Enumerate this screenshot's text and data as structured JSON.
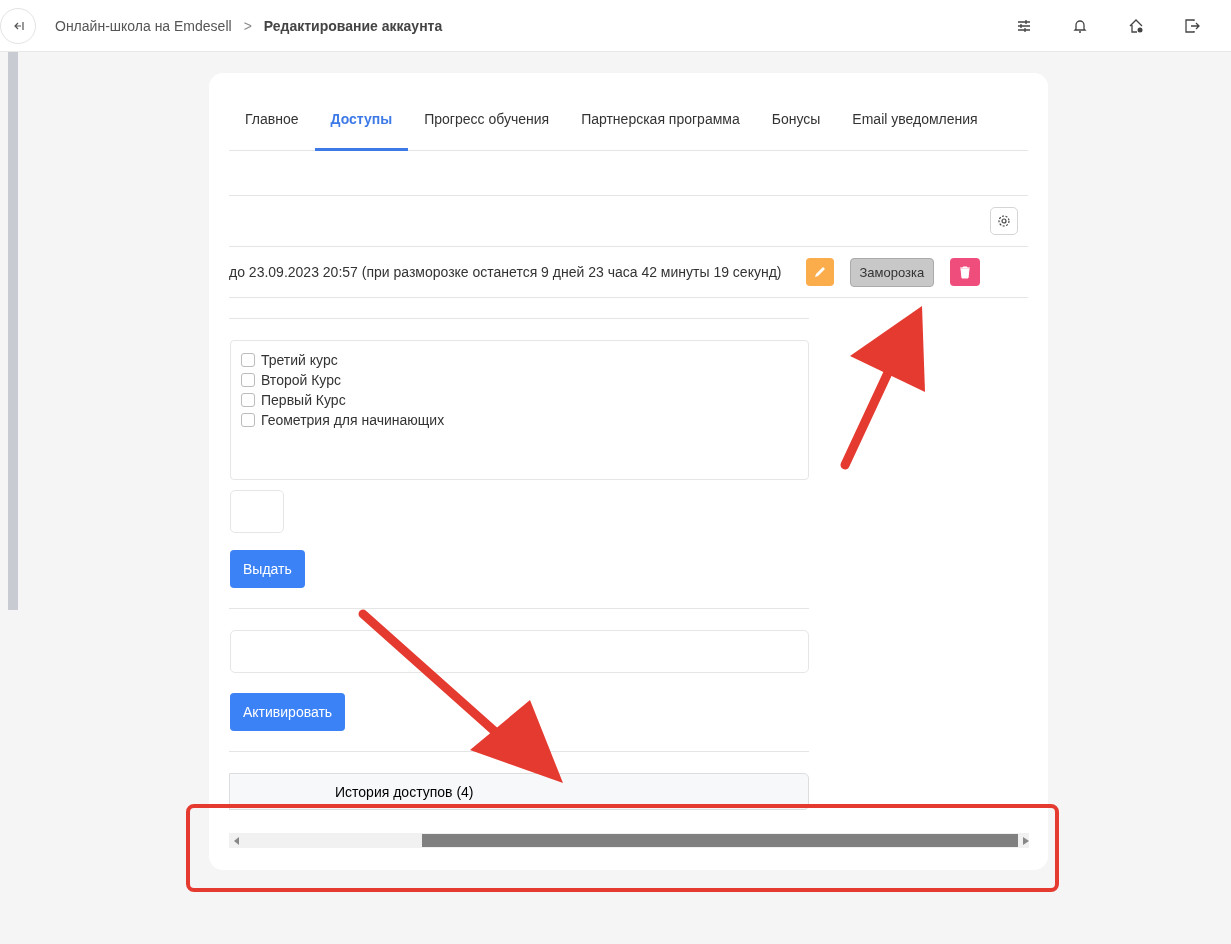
{
  "breadcrumb": {
    "parent": "Онлайн-школа на Emdesell",
    "separator": ">",
    "current": "Редактирование аккаунта"
  },
  "tabs": [
    {
      "label": "Главное",
      "selected": false
    },
    {
      "label": "Доступы",
      "selected": true
    },
    {
      "label": "Прогресс обучения",
      "selected": false
    },
    {
      "label": "Партнерская программа",
      "selected": false
    },
    {
      "label": "Бонусы",
      "selected": false
    },
    {
      "label": "Email уведомления",
      "selected": false
    }
  ],
  "access": {
    "text": "до 23.09.2023 20:57 (при разморозке останется 9 дней 23 часа 42 минуты 19 секунд)",
    "freeze_button": "Заморозка"
  },
  "courses": [
    {
      "label": "Третий курс",
      "checked": false
    },
    {
      "label": "Второй Курс",
      "checked": false
    },
    {
      "label": "Первый Курс",
      "checked": false
    },
    {
      "label": "Геометрия для начинающих",
      "checked": false
    }
  ],
  "grant_button": "Выдать",
  "activate_button": "Активировать",
  "history": {
    "label": "История доступов (4)",
    "expanded": false
  }
}
